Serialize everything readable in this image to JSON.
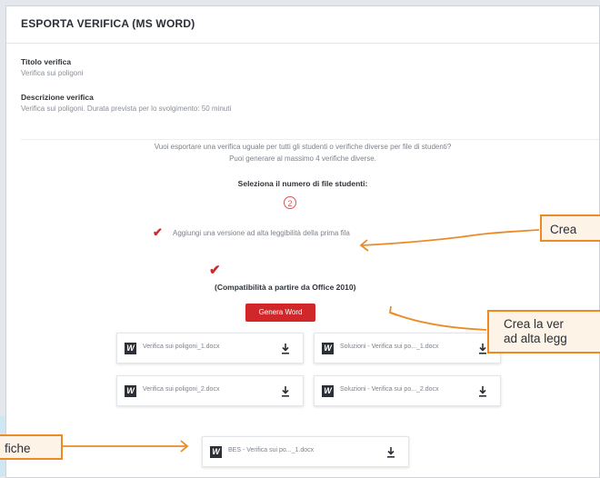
{
  "header": {
    "title": "ESPORTA VERIFICA (MS WORD)"
  },
  "form": {
    "title_label": "Titolo verifica",
    "title_value": "Verifica sui poligoni",
    "desc_label": "Descrizione verifica",
    "desc_value": "Verifica sui poligoni. Durata prevista per lo svolgimento: 50 minuti"
  },
  "info": {
    "line1": "Vuoi esportare una verifica uguale per tutti gli studenti o verifiche diverse per file di studenti?",
    "line2": "Puoi generare al massimo 4 verifiche diverse."
  },
  "select_rows": {
    "label": "Seleziona il numero di file studenti:",
    "value": "2"
  },
  "checkbox": {
    "label": "Aggiungi una versione ad alta leggibilità della prima fila",
    "checked": true
  },
  "compat": "(Compatibilità a partire da Office 2010)",
  "generate_button": "Genera Word",
  "files": [
    {
      "name": "Verifica sui poligoni_1.docx"
    },
    {
      "name": "Soluzioni - Verifica sui po..._1.docx"
    },
    {
      "name": "Verifica sui poligoni_2.docx"
    },
    {
      "name": "Soluzioni - Verifica sui po..._2.docx"
    },
    {
      "name": "BES - Verifica sui po..._1.docx"
    }
  ],
  "callouts": {
    "c1": "Crea",
    "c2_line1": "Crea la ver",
    "c2_line2": "ad alta legg",
    "c3": "fiche"
  },
  "colors": {
    "accent_red": "#d0272a",
    "callout_orange": "#ec8a25"
  },
  "icons": {
    "file": "word-icon",
    "download": "download-icon",
    "check": "checkmark-icon"
  }
}
